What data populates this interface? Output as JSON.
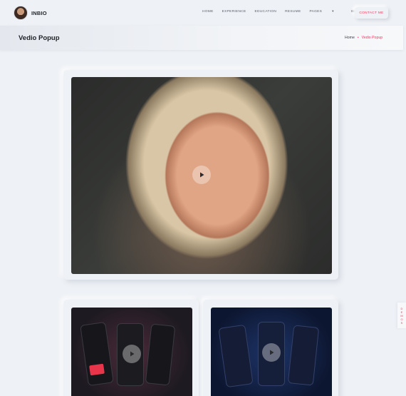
{
  "header": {
    "brand": "INBIO",
    "nav": [
      "HOME",
      "EXPERIENCE",
      "EDUCATION",
      "RESUME",
      "PAGES",
      "BLOG",
      "FOOTER"
    ],
    "contact_label": "CONTACT ME"
  },
  "banner": {
    "title": "Vedio Popup",
    "breadcrumb_home": "Home",
    "breadcrumb_sep": "•",
    "breadcrumb_current": "Vedio Popup"
  },
  "side_tab": [
    "D",
    "E",
    "M",
    "O",
    "S"
  ],
  "colors": {
    "accent": "#f3355c",
    "background": "#eef1f5"
  }
}
